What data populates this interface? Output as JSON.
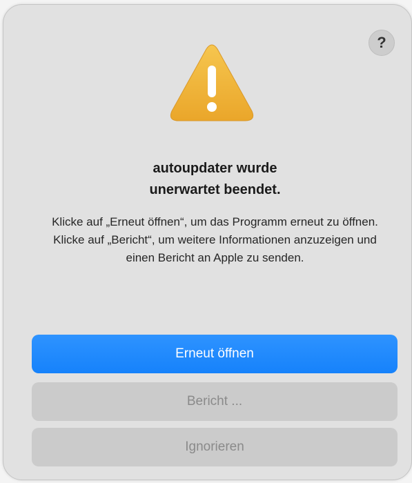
{
  "dialog": {
    "help_label": "?",
    "icon": "warning-triangle-icon",
    "title_line1": "autoupdater wurde",
    "title_line2": "unerwartet beendet.",
    "message": "Klicke auf „Erneut öffnen“, um das Programm erneut zu öffnen. Klicke auf „Bericht“, um weitere Informationen anzuzeigen und einen Bericht an Apple zu senden.",
    "buttons": {
      "reopen": "Erneut öffnen",
      "report": "Bericht ...",
      "ignore": "Ignorieren"
    }
  },
  "colors": {
    "accent": "#1682fb",
    "warning": "#f2b53a"
  }
}
